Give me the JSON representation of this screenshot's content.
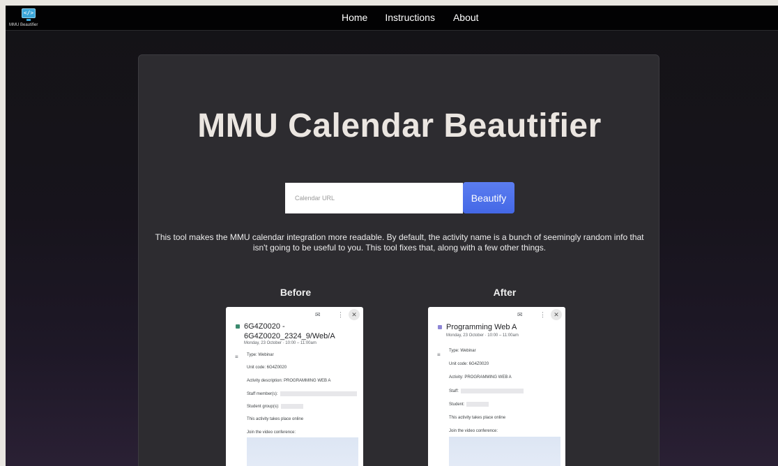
{
  "nav": {
    "logo_text": "MMU Beautifier",
    "logo_glyph": "</>",
    "home": "Home",
    "instructions": "Instructions",
    "about": "About"
  },
  "hero": {
    "title": "MMU Calendar Beautifier",
    "input_placeholder": "Calendar URL",
    "input_value": "",
    "button_label": "Beautify",
    "description": "This tool makes the MMU calendar integration more readable. By default, the activity name is a bunch of seemingly random info that isn't going to be useful to you. This tool fixes that, along with a few other things."
  },
  "comparison": {
    "before": {
      "heading": "Before",
      "dot_color": "#3b8a6e",
      "event_title": "6G4Z0020 - 6G4Z0020_2324_9/Web/A",
      "date": "Monday, 23 October · 10:00 – 11:00am",
      "rows": [
        "Type: Webinar",
        "Unit code: 6G4Z0020",
        "Activity description: PROGRAMMING WEB A",
        "Staff member(s):",
        "Student group(s):",
        "This activity takes place online",
        "Join the video conference:"
      ]
    },
    "after": {
      "heading": "After",
      "dot_color": "#8e86d6",
      "event_title": "Programming Web A",
      "date": "Monday, 23 October · 10:00 – 11:00am",
      "rows": [
        "Type: Webinar",
        "Unit code: 6G4Z0020",
        "Activity: PROGRAMMING WEB A",
        "Staff:",
        "Student:",
        "This activity takes place online",
        "Join the video conference:"
      ]
    }
  },
  "colors": {
    "accent_button": "#4a6ee8",
    "title": "#ebe6e1",
    "card": "#2d2c30"
  }
}
